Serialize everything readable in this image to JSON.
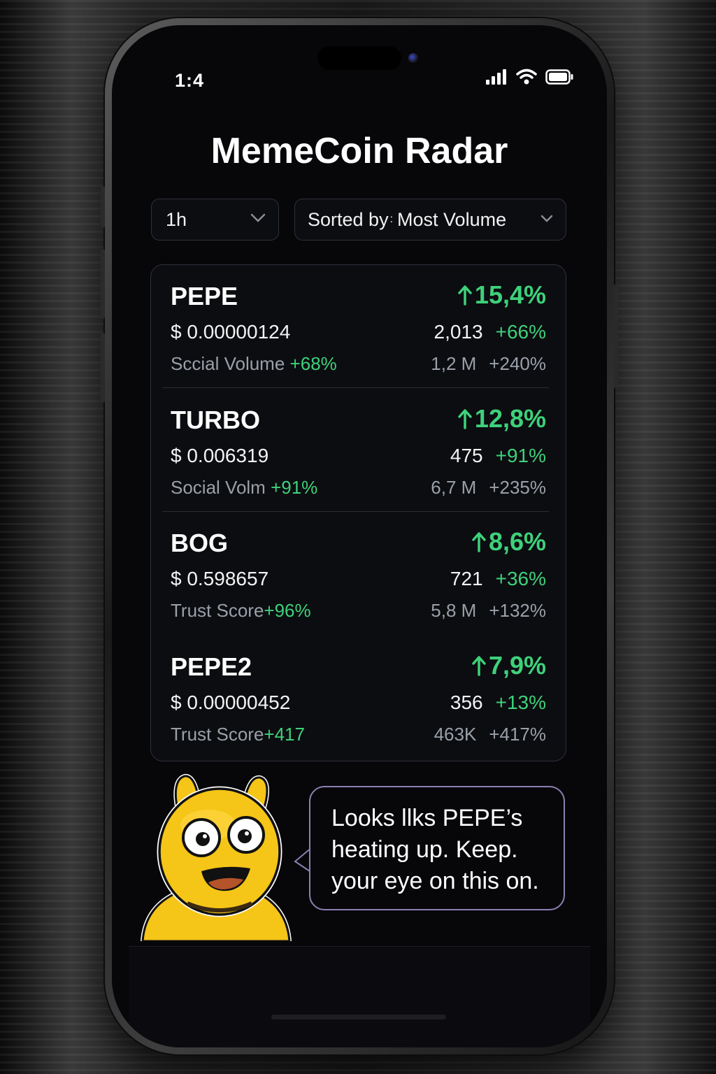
{
  "status_bar": {
    "time": "1:4"
  },
  "app": {
    "title": "MemeCoin Radar"
  },
  "filters": {
    "timeframe": "1h",
    "sort_prefix": "Sorted by",
    "sort_separator": ":",
    "sort_value": "Most Volume"
  },
  "coins": [
    {
      "symbol": "PEPE",
      "price": "$ 0.00000124",
      "metric_label": "Sccial Volume",
      "metric_value": "+68%",
      "change": "15,4%",
      "stat_a": "2,013",
      "stat_a_change": "+66%",
      "stat_b": "1,2 M",
      "stat_b_change": "+240%"
    },
    {
      "symbol": "TURBO",
      "price": "$ 0.006319",
      "metric_label": "Social Volm",
      "metric_value": "+91%",
      "change": "12,8%",
      "stat_a": "475",
      "stat_a_change": "+91%",
      "stat_b": "6,7 M",
      "stat_b_change": "+235%"
    },
    {
      "symbol": "BOG",
      "price": "$ 0.598657",
      "metric_label": "Trust Score",
      "metric_value": "+96%",
      "change": "8,6%",
      "stat_a": "721",
      "stat_a_change": "+36%",
      "stat_b": "5,8 M",
      "stat_b_change": "+132%"
    },
    {
      "symbol": "PEPE2",
      "price": "$ 0.00000452",
      "metric_label": "Trust Score",
      "metric_value": "+417",
      "change": "7,9%",
      "stat_a": "356",
      "stat_a_change": "+13%",
      "stat_b": "463K",
      "stat_b_change": "+417%"
    }
  ],
  "assistant": {
    "lines": [
      "Looks llks PEPE’s",
      "heating up. Keep.",
      "your eye on this on."
    ]
  },
  "colors": {
    "positive": "#3ed17a",
    "muted": "#9aa0a8",
    "background": "#07070a",
    "mascot": "#f5c518"
  },
  "icons": [
    "signal-icon",
    "wifi-icon",
    "battery-icon",
    "chevron-down-icon",
    "arrow-up-icon",
    "mascot-character"
  ]
}
